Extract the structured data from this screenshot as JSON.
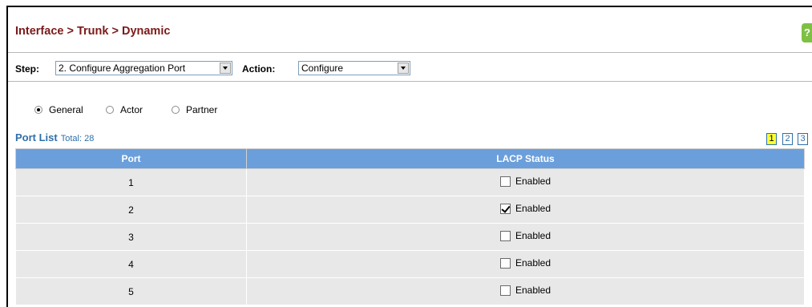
{
  "header": {
    "breadcrumb": "Interface > Trunk > Dynamic",
    "help_icon": "help-icon"
  },
  "toolbar": {
    "step_label": "Step:",
    "step_value": "2. Configure Aggregation Port",
    "action_label": "Action:",
    "action_value": "Configure"
  },
  "view_options": [
    {
      "label": "General",
      "selected": true
    },
    {
      "label": "Actor",
      "selected": false
    },
    {
      "label": "Partner",
      "selected": false
    }
  ],
  "port_list": {
    "title": "Port List",
    "total": "Total: 28",
    "pages": [
      "1",
      "2",
      "3"
    ],
    "current_page": "1",
    "columns": [
      "Port",
      "LACP Status"
    ],
    "rows": [
      {
        "port": "1",
        "lacp_label": "Enabled",
        "lacp_checked": false
      },
      {
        "port": "2",
        "lacp_label": "Enabled",
        "lacp_checked": true
      },
      {
        "port": "3",
        "lacp_label": "Enabled",
        "lacp_checked": false
      },
      {
        "port": "4",
        "lacp_label": "Enabled",
        "lacp_checked": false
      },
      {
        "port": "5",
        "lacp_label": "Enabled",
        "lacp_checked": false
      }
    ]
  },
  "colors": {
    "title": "#7b1a1a",
    "header_bg": "#6b9fdb",
    "link": "#2f6fa8",
    "current_page": "#ffff33"
  }
}
